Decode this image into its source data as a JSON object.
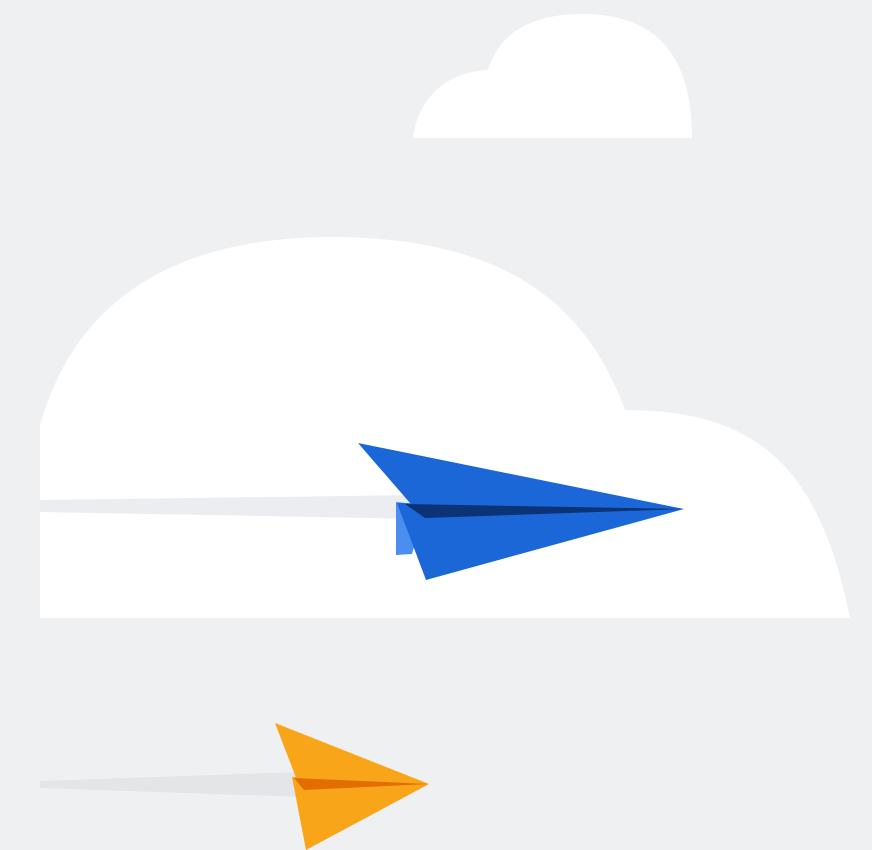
{
  "scene": {
    "background_color": "#eff0f2",
    "elements": [
      {
        "name": "small-cloud",
        "type": "cloud",
        "color": "#ffffff"
      },
      {
        "name": "large-cloud",
        "type": "cloud",
        "color": "#ffffff"
      },
      {
        "name": "blue-paper-plane",
        "type": "paper-plane-icon",
        "colors": {
          "main": "#1b67d8",
          "fold": "#0b3376",
          "underside": "#4b8ef0"
        }
      },
      {
        "name": "blue-plane-trail",
        "type": "motion-trail",
        "color": "#ebedf0"
      },
      {
        "name": "orange-paper-plane",
        "type": "paper-plane-icon",
        "colors": {
          "main": "#f9a51a",
          "fold": "#e26d00"
        }
      },
      {
        "name": "orange-plane-trail",
        "type": "motion-trail",
        "color": "#e4e5e8"
      }
    ]
  }
}
